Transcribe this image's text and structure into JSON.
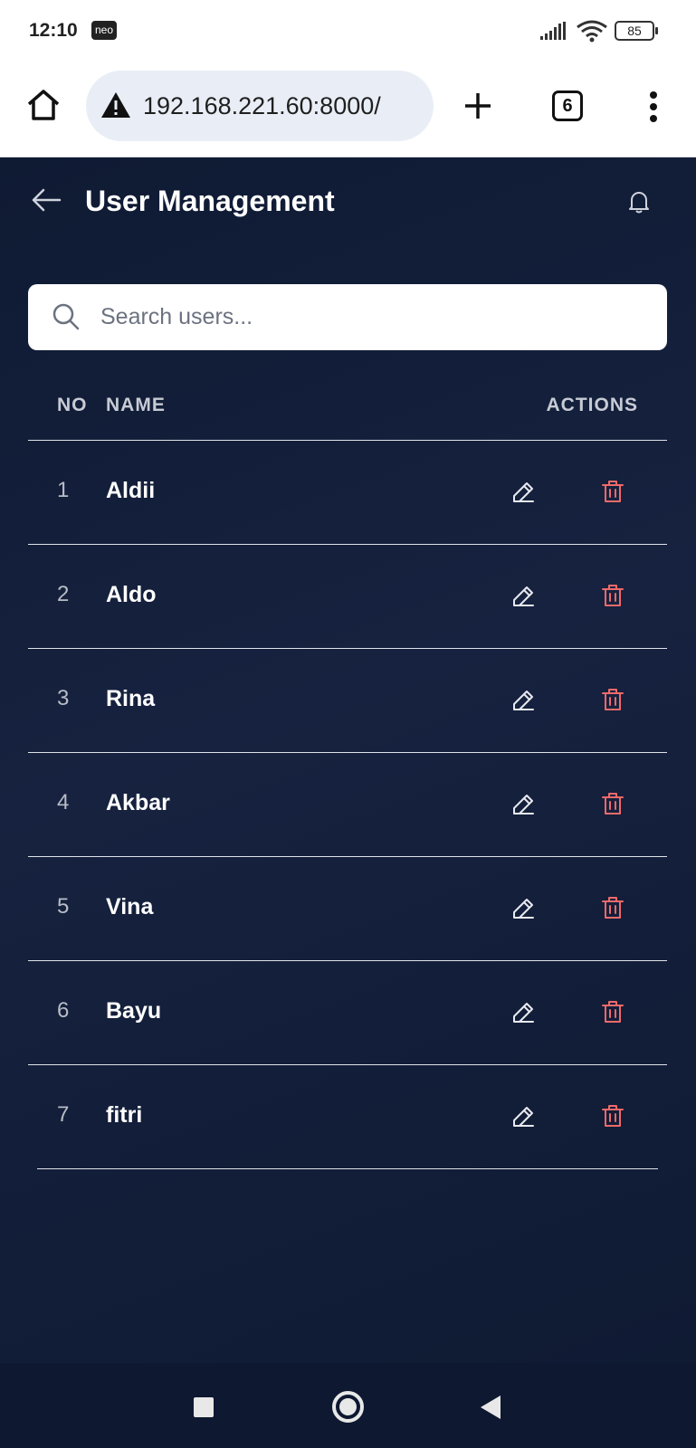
{
  "status_bar": {
    "time": "12:10",
    "badge": "neo",
    "battery": "85"
  },
  "browser": {
    "url": "192.168.221.60:8000/",
    "tab_count": "6"
  },
  "header": {
    "title": "User Management"
  },
  "search": {
    "placeholder": "Search users..."
  },
  "table": {
    "headers": {
      "no": "NO",
      "name": "NAME",
      "actions": "ACTIONS"
    },
    "rows": [
      {
        "no": "1",
        "name": "Aldii"
      },
      {
        "no": "2",
        "name": "Aldo"
      },
      {
        "no": "3",
        "name": "Rina"
      },
      {
        "no": "4",
        "name": "Akbar"
      },
      {
        "no": "5",
        "name": "Vina"
      },
      {
        "no": "6",
        "name": "Bayu"
      },
      {
        "no": "7",
        "name": "fitri"
      }
    ]
  },
  "icons": {
    "edit": "pencil-icon",
    "delete": "trash-icon"
  },
  "colors": {
    "background": "#0f1a33",
    "delete_accent": "#f06a6a",
    "text_primary": "#ffffff"
  }
}
